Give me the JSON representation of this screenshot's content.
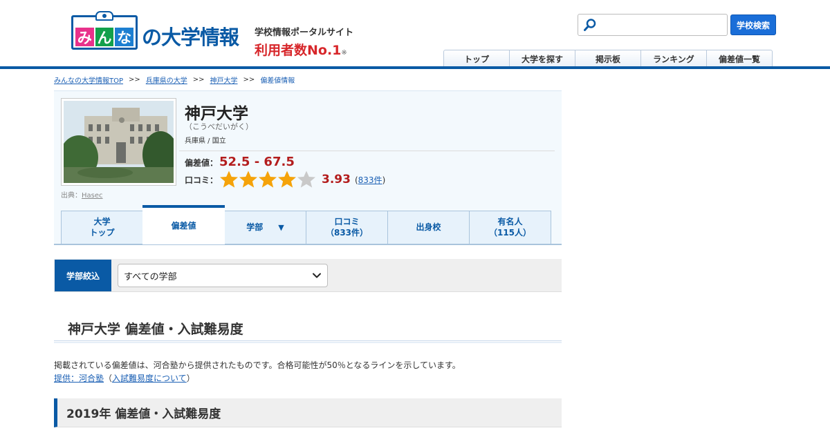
{
  "header": {
    "logo_chars": [
      "み",
      "ん",
      "な"
    ],
    "logo_text": "の大学情報",
    "tagline_sub": "学校情報ポータルサイト",
    "tagline_main": "利用者数No.1",
    "tagline_note": "※",
    "search": {
      "placeholder": "",
      "value": "",
      "button_label": "学校検索"
    },
    "nav": [
      "トップ",
      "大学を探す",
      "掲示板",
      "ランキング",
      "偏差値一覧"
    ]
  },
  "breadcrumb": {
    "items": [
      "みんなの大学情報TOP",
      "兵庫県の大学",
      "神戸大学"
    ],
    "current": "偏差値情報",
    "separator": ">>"
  },
  "school": {
    "name": "神戸大学",
    "kana": "（こうべだいがく）",
    "meta": "兵庫県 / 国立",
    "photo_credit_label": "出典：",
    "photo_credit_link": "Hasec",
    "hensachi_label": "偏差値：",
    "hensachi_value": "52.5 - 67.5",
    "kuchikomi_label": "口コミ：",
    "rating": "3.93",
    "rating_value": 3.93,
    "review_open": "(",
    "review_count": "833件",
    "review_close": ")"
  },
  "tabs": [
    {
      "label": "大学\nトップ",
      "active": false
    },
    {
      "label": "偏差値",
      "active": true
    },
    {
      "label": "学部",
      "active": false,
      "dropdown": true
    },
    {
      "label": "口コミ\n（833件）",
      "active": false
    },
    {
      "label": "出身校",
      "active": false
    },
    {
      "label": "有名人\n（115人）",
      "active": false
    }
  ],
  "tab_caret": "▼",
  "filter": {
    "label": "学部絞込",
    "selected": "すべての学部"
  },
  "section": {
    "title": "神戸大学 偏差値・入試難易度",
    "note": "掲載されている偏差値は、河合塾から提供されたものです。合格可能性が50％となるラインを示しています。",
    "provider_link": "提供：河合塾",
    "paren_open": "（",
    "about_link": "入試難易度について",
    "paren_close": "）",
    "year_heading": "2019年 偏差値・入試難易度"
  },
  "colors": {
    "brand_blue": "#0a5aa5",
    "accent_red": "#d7262a",
    "star_gold": "#f5a30a",
    "star_empty": "#c9c9c9"
  }
}
